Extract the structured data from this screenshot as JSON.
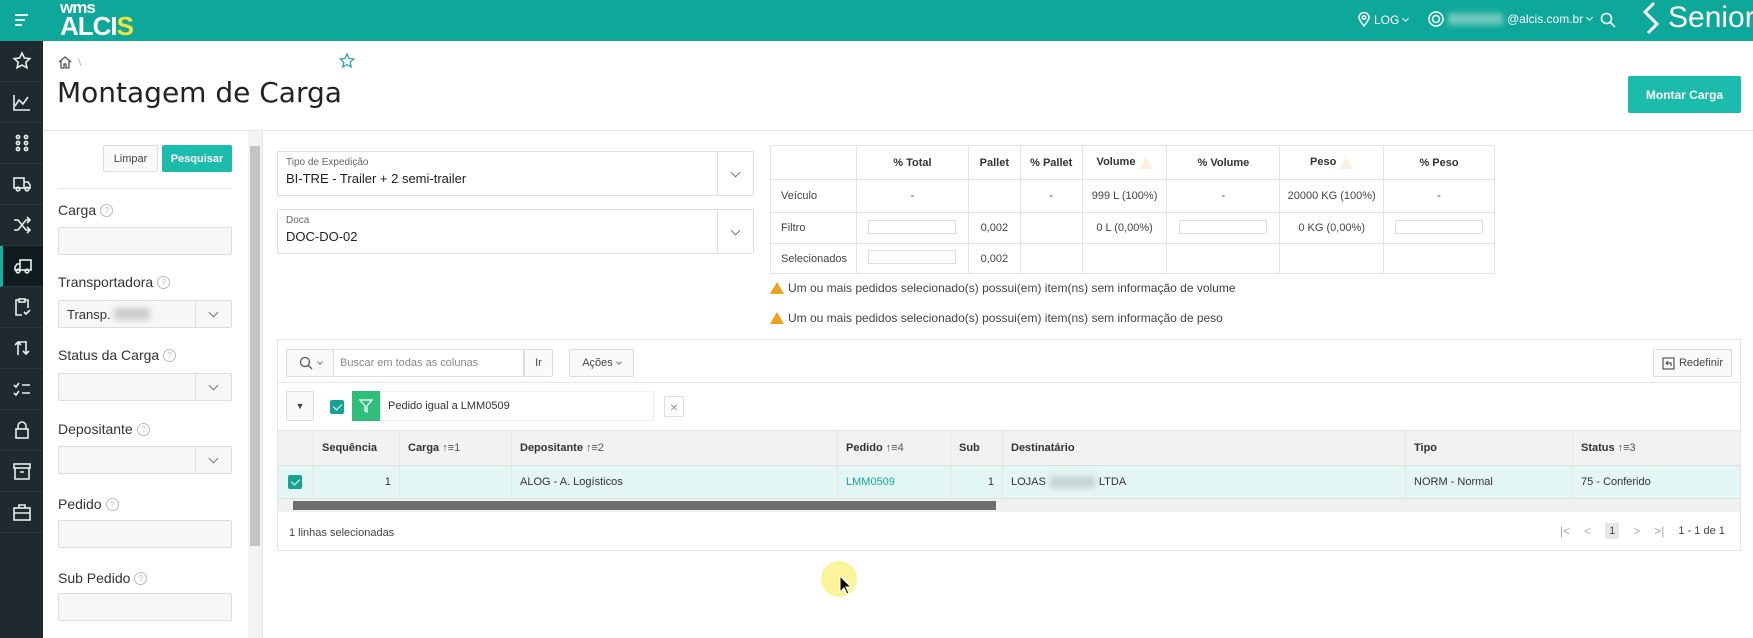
{
  "topbar": {
    "logo_top": "wms",
    "logo_main": "ALCI",
    "logo_accent": "S",
    "location": "LOG",
    "user_email": "@alcis.com.br",
    "brand": "Senior"
  },
  "sidebar": {
    "items": [
      "favorites",
      "dashboard",
      "apps",
      "shipping",
      "routing",
      "load-building",
      "checklist",
      "transfer",
      "tasks",
      "security",
      "archive",
      "tools"
    ],
    "active": "load-building"
  },
  "page": {
    "title": "Montagem de Carga",
    "action_button": "Montar Carga"
  },
  "filters": {
    "clear": "Limpar",
    "search": "Pesquisar",
    "fields": [
      {
        "label": "Carga",
        "value": ""
      },
      {
        "label": "Transportadora",
        "value": "Transp."
      },
      {
        "label": "Status da Carga",
        "value": ""
      },
      {
        "label": "Depositante",
        "value": ""
      },
      {
        "label": "Pedido",
        "value": ""
      },
      {
        "label": "Sub Pedido",
        "value": ""
      }
    ]
  },
  "expedicao": {
    "label": "Tipo de Expedição",
    "value": "BI-TRE - Trailer + 2 semi-trailer"
  },
  "doca": {
    "label": "Doca",
    "value": "DOC-DO-02"
  },
  "stats": {
    "headers": [
      "",
      "% Total",
      "Pallet",
      "% Pallet",
      "Volume",
      "% Volume",
      "Peso",
      "% Peso"
    ],
    "rows": [
      [
        "Veículo",
        "-",
        "",
        "-",
        "999 L (100%)",
        "-",
        "20000 KG (100%)",
        "-"
      ],
      [
        "Filtro",
        "",
        "0,002",
        "",
        "0 L (0,00%)",
        "",
        "0 KG (0,00%)",
        ""
      ],
      [
        "Selecionados",
        "",
        "0,002",
        "",
        "",
        "",
        "",
        ""
      ]
    ]
  },
  "warnings": [
    "Um ou mais pedidos selecionado(s) possui(em) item(ns) sem informação de volume",
    "Um ou mais pedidos selecionado(s) possui(em) item(ns) sem informação de peso"
  ],
  "grid": {
    "search_placeholder": "Buscar em todas as colunas",
    "go": "Ir",
    "actions": "Ações",
    "reset": "Redefinir",
    "filter_text": "Pedido igual a LMM0509",
    "columns": [
      {
        "label": "Sequência",
        "sort": ""
      },
      {
        "label": "Carga",
        "sort": "↑≡1"
      },
      {
        "label": "Depositante",
        "sort": "↑≡2"
      },
      {
        "label": "Pedido",
        "sort": "↑≡4"
      },
      {
        "label": "Sub",
        "sort": ""
      },
      {
        "label": "Destinatário",
        "sort": ""
      },
      {
        "label": "Tipo",
        "sort": ""
      },
      {
        "label": "Status",
        "sort": "↑≡3"
      }
    ],
    "rows": [
      {
        "seq": "1",
        "carga": "",
        "depositante": "ALOG - A. Logísticos",
        "pedido": "LMM0509",
        "sub": "1",
        "dest_a": "LOJAS",
        "dest_b": "LTDA",
        "tipo": "NORM - Normal",
        "status": "75 - Conferido"
      }
    ],
    "selected_text": "1 linhas selecionadas",
    "page": "1",
    "range": "1 - 1 de 1"
  }
}
